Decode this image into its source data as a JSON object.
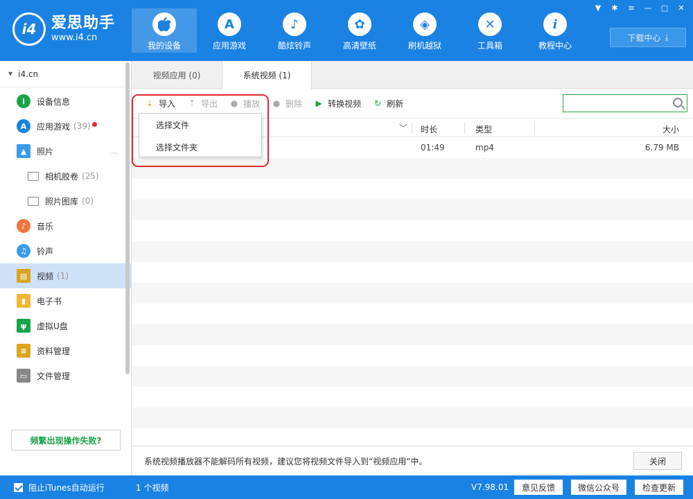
{
  "app": {
    "logo_badge": "i4",
    "name": "爱思助手",
    "url": "www.i4.cn"
  },
  "nav": [
    {
      "label": "我的设备",
      "icon": "apple-icon",
      "glyph": ""
    },
    {
      "label": "应用游戏",
      "icon": "app-store-icon",
      "glyph": "A"
    },
    {
      "label": "酷炫铃声",
      "icon": "bell-icon",
      "glyph": "♪"
    },
    {
      "label": "高清壁纸",
      "icon": "flower-icon",
      "glyph": "✿"
    },
    {
      "label": "刷机越狱",
      "icon": "dropbox-icon",
      "glyph": "◈"
    },
    {
      "label": "工具箱",
      "icon": "tools-icon",
      "glyph": "✕"
    },
    {
      "label": "教程中心",
      "icon": "info-icon",
      "glyph": "i"
    }
  ],
  "window": {
    "download_center": "下载中心"
  },
  "sidebar": {
    "device": "i4.cn",
    "items": [
      {
        "label": "设备信息",
        "count": "",
        "icon": "info-circle-icon",
        "color": "#1aa34a"
      },
      {
        "label": "应用游戏",
        "count": "(39)",
        "icon": "app-store-icon",
        "color": "#1a82e2"
      },
      {
        "label": "照片",
        "count": "",
        "icon": "photo-icon",
        "color": "#3a9be8"
      },
      {
        "label": "相机胶卷",
        "count": "(25)",
        "icon": "folder-icon",
        "color": "#888888"
      },
      {
        "label": "照片图库",
        "count": "(0)",
        "icon": "folder-icon",
        "color": "#888888"
      },
      {
        "label": "音乐",
        "count": "",
        "icon": "music-icon",
        "color": "#f0743c"
      },
      {
        "label": "铃声",
        "count": "",
        "icon": "bell-icon",
        "color": "#3a9be8"
      },
      {
        "label": "视频",
        "count": "(1)",
        "icon": "film-icon",
        "color": "#d9a520"
      },
      {
        "label": "电子书",
        "count": "",
        "icon": "book-icon",
        "color": "#f2b632"
      },
      {
        "label": "虚拟U盘",
        "count": "",
        "icon": "usb-icon",
        "color": "#1aa34a"
      },
      {
        "label": "资料管理",
        "count": "",
        "icon": "notes-icon",
        "color": "#d9a520"
      },
      {
        "label": "文件管理",
        "count": "",
        "icon": "file-icon",
        "color": "#888888"
      }
    ],
    "help_button": "频繁出现操作失败?"
  },
  "tabs": [
    {
      "label": "视频应用 (0)"
    },
    {
      "label": "系统视频 (1)"
    }
  ],
  "toolbar": {
    "import": "导入",
    "export": "导出",
    "play": "播放",
    "delete": "删除",
    "convert": "转换视频",
    "refresh": "刷新"
  },
  "dropdown": {
    "items": [
      "选择文件",
      "选择文件夹"
    ]
  },
  "table": {
    "headers": {
      "duration": "时长",
      "type": "类型",
      "size": "大小"
    },
    "rows": [
      {
        "duration": "01:49",
        "type": "mp4",
        "size": "6.79 MB"
      }
    ]
  },
  "notice": {
    "text": "系统视频播放器不能解码所有视频，建议您将视频文件导入到“视频应用”中。",
    "close": "关闭"
  },
  "status": {
    "itunes_label": "阻止iTunes自动运行",
    "video_count": "1 个视频",
    "version": "V7.98.01",
    "feedback": "意见反馈",
    "wechat": "微信公众号",
    "check_update": "检查更新"
  }
}
